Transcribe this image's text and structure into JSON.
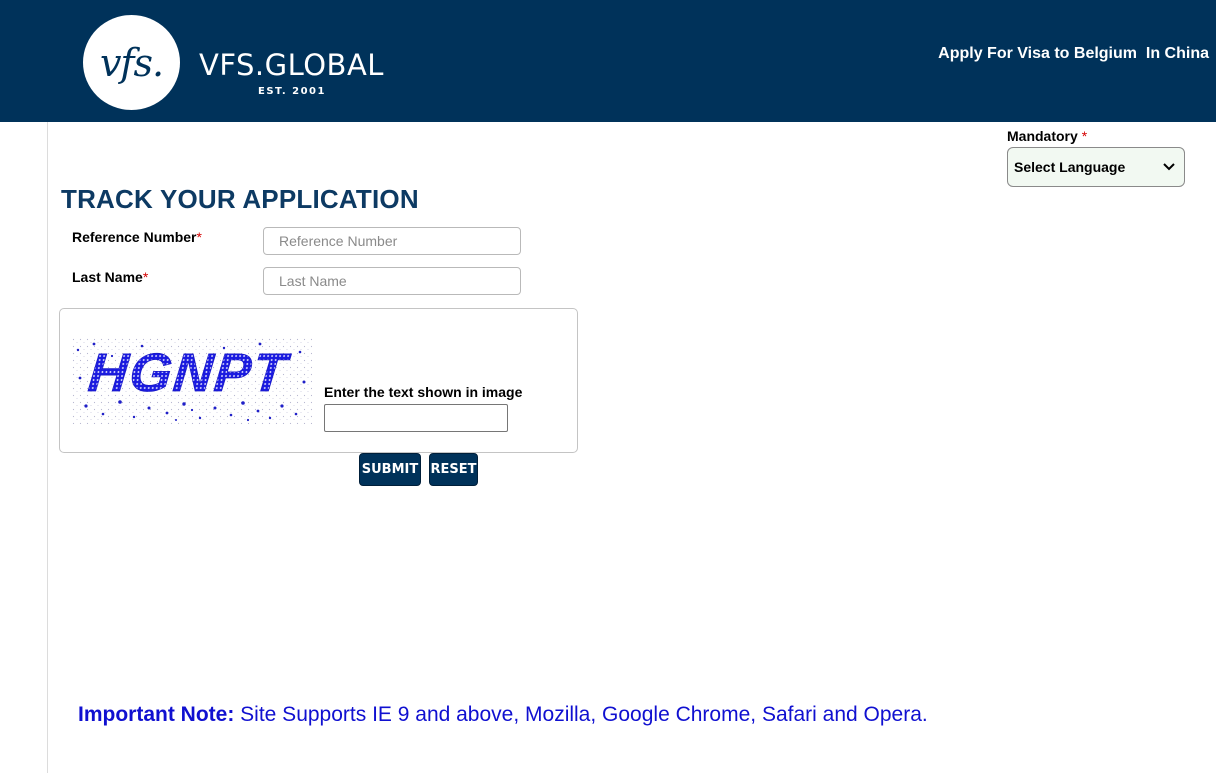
{
  "header": {
    "logo_mark": "vfs.",
    "logo_word": "VFS.GLOBAL",
    "logo_est": "EST. 2001",
    "title": "Apply For Visa to Belgium  In China",
    "background": "#00325a"
  },
  "language": {
    "mandatory_label": "Mandatory",
    "required_mark": "*",
    "selected": "Select Language"
  },
  "form": {
    "title": "TRACK YOUR APPLICATION",
    "reference_label": "Reference Number",
    "reference_placeholder": "Reference Number",
    "last_name_label": "Last Name",
    "last_name_placeholder": "Last Name",
    "required_mark": "*"
  },
  "captcha": {
    "image_text": "HGNPT",
    "label": "Enter the text shown in image",
    "value": ""
  },
  "buttons": {
    "submit": "SUBMIT",
    "reset": "RESET"
  },
  "note": {
    "prefix": "Important Note:",
    "text": " Site Supports IE 9 and above, Mozilla, Google Chrome, Safari and Opera."
  },
  "colors": {
    "brand_navy": "#00325a",
    "title_blue": "#0d3a63",
    "required_red": "#d40000",
    "note_blue": "#1010d0"
  }
}
